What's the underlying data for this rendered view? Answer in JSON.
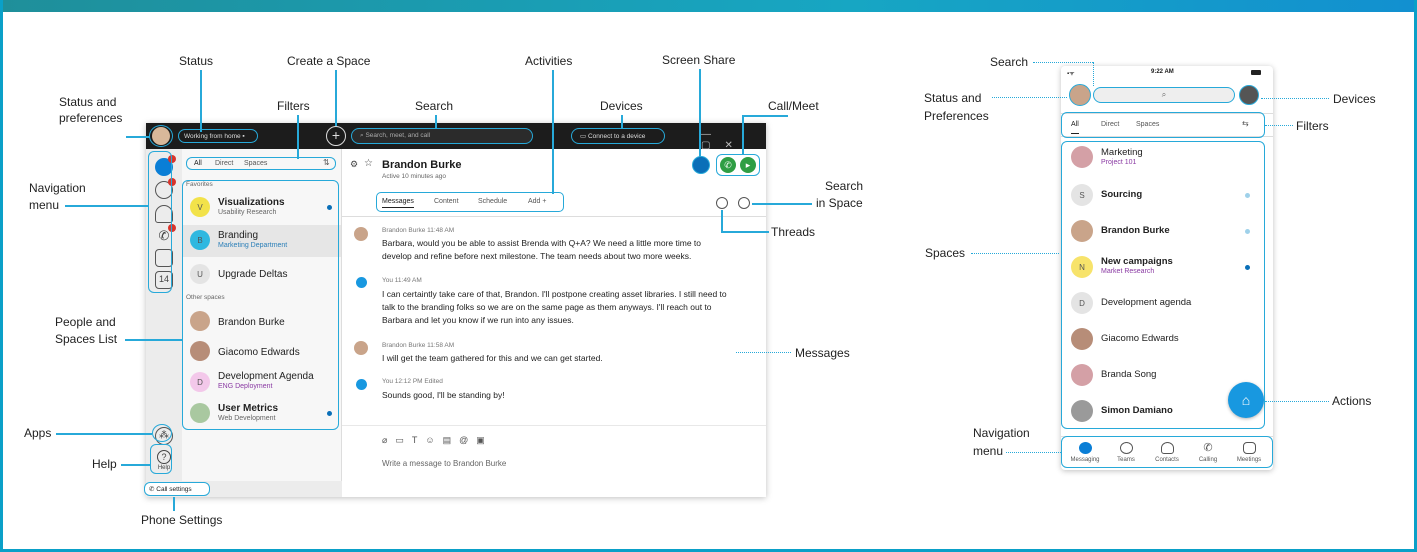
{
  "colors": {
    "accent": "#27a9d9",
    "title_bar": "#1c1c1c",
    "active": "#0a7ed6",
    "call_green": "#2f9e44",
    "badge_red": "#d9342b",
    "purple": "#8a3aa3"
  },
  "desktop": {
    "status_text": "Working from home",
    "search_placeholder": "Search, meet, and call",
    "devices_button": "Connect to a device",
    "filters": [
      "All",
      "Direct",
      "Spaces"
    ],
    "favorites_heading": "Favorites",
    "other_heading": "Other spaces",
    "spaces": [
      {
        "initial": "V",
        "title": "Visualizations",
        "sub": "Usability Research",
        "bold": true,
        "unread": true
      },
      {
        "initial": "B",
        "title": "Branding",
        "sub": "Marketing Department",
        "bold": false,
        "unread": false
      },
      {
        "initial": "U",
        "title": "Upgrade Deltas",
        "sub": "",
        "bold": false,
        "unread": false
      },
      {
        "initial": "",
        "title": "Brandon Burke",
        "sub": "",
        "bold": false,
        "unread": false
      },
      {
        "initial": "",
        "title": "Giacomo Edwards",
        "sub": "",
        "bold": false,
        "unread": false
      },
      {
        "initial": "D",
        "title": "Development Agenda",
        "sub": "ENG Deployment",
        "bold": false,
        "unread": false
      },
      {
        "initial": "",
        "title": "User Metrics",
        "sub": "Web Development",
        "bold": true,
        "unread": true
      }
    ],
    "contact_name": "Brandon Burke",
    "contact_status": "Active 10 minutes ago",
    "tabs": [
      "Messages",
      "Content",
      "Schedule",
      "Add +"
    ],
    "messages": [
      {
        "meta": "Brandon Burke  11:48 AM",
        "text": "Barbara, would you be able to assist Brenda with Q+A? We need a little more time to develop and refine before next milestone. The team needs about two more weeks."
      },
      {
        "meta": "You  11:49 AM",
        "text": "I can certaintly take care of that, Brandon. I'll postpone creating asset libraries. I still need to talk to the branding folks so we are on the same page as them anyways. I'll reach out to Barbara and let you know if we run into any issues."
      },
      {
        "meta": "Brandon Burke  11:58 AM",
        "text": "I will get the team gathered for this and we can get started."
      },
      {
        "meta": "You  12:12 PM Edited",
        "text": "Sounds good, I'll be standing by!"
      }
    ],
    "composer_placeholder": "Write a message to Brandon Burke",
    "help_label": "Help",
    "call_settings": "Call settings"
  },
  "labels": {
    "status": "Status",
    "create_space": "Create a Space",
    "activities": "Activities",
    "screen_share": "Screen Share",
    "status_prefs_1": "Status and",
    "status_prefs_2": "preferences",
    "filters": "Filters",
    "search": "Search",
    "devices": "Devices",
    "call_meet": "Call/Meet",
    "nav_menu_1": "Navigation",
    "nav_menu_2": "menu",
    "search_space_1": "Search",
    "search_space_2": "in Space",
    "threads": "Threads",
    "people_spaces_1": "People and",
    "people_spaces_2": "Spaces List",
    "messages": "Messages",
    "apps": "Apps",
    "help": "Help",
    "phone_settings": "Phone Settings"
  },
  "mobile": {
    "time": "9:22 AM",
    "filters": [
      "All",
      "Direct",
      "Spaces"
    ],
    "spaces": [
      {
        "initial": "",
        "title": "Marketing",
        "sub": "Project 101",
        "bold": false,
        "dot": false
      },
      {
        "initial": "S",
        "title": "Sourcing",
        "sub": "",
        "bold": true,
        "dot": true
      },
      {
        "initial": "",
        "title": "Brandon Burke",
        "sub": "",
        "bold": true,
        "dot": true
      },
      {
        "initial": "N",
        "title": "New campaigns",
        "sub": "Market Research",
        "bold": true,
        "dot": true
      },
      {
        "initial": "D",
        "title": "Development agenda",
        "sub": "",
        "bold": false,
        "dot": false
      },
      {
        "initial": "",
        "title": "Giacomo Edwards",
        "sub": "",
        "bold": false,
        "dot": false
      },
      {
        "initial": "",
        "title": "Branda Song",
        "sub": "",
        "bold": false,
        "dot": false
      },
      {
        "initial": "",
        "title": "Simon Damiano",
        "sub": "",
        "bold": true,
        "dot": false
      }
    ],
    "nav": [
      "Messaging",
      "Teams",
      "Contacts",
      "Calling",
      "Meetings"
    ],
    "labels": {
      "search": "Search",
      "status_prefs_1": "Status and",
      "status_prefs_2": "Preferences",
      "devices": "Devices",
      "filters": "Filters",
      "spaces": "Spaces",
      "actions": "Actions",
      "nav_menu_1": "Navigation",
      "nav_menu_2": "menu"
    }
  }
}
